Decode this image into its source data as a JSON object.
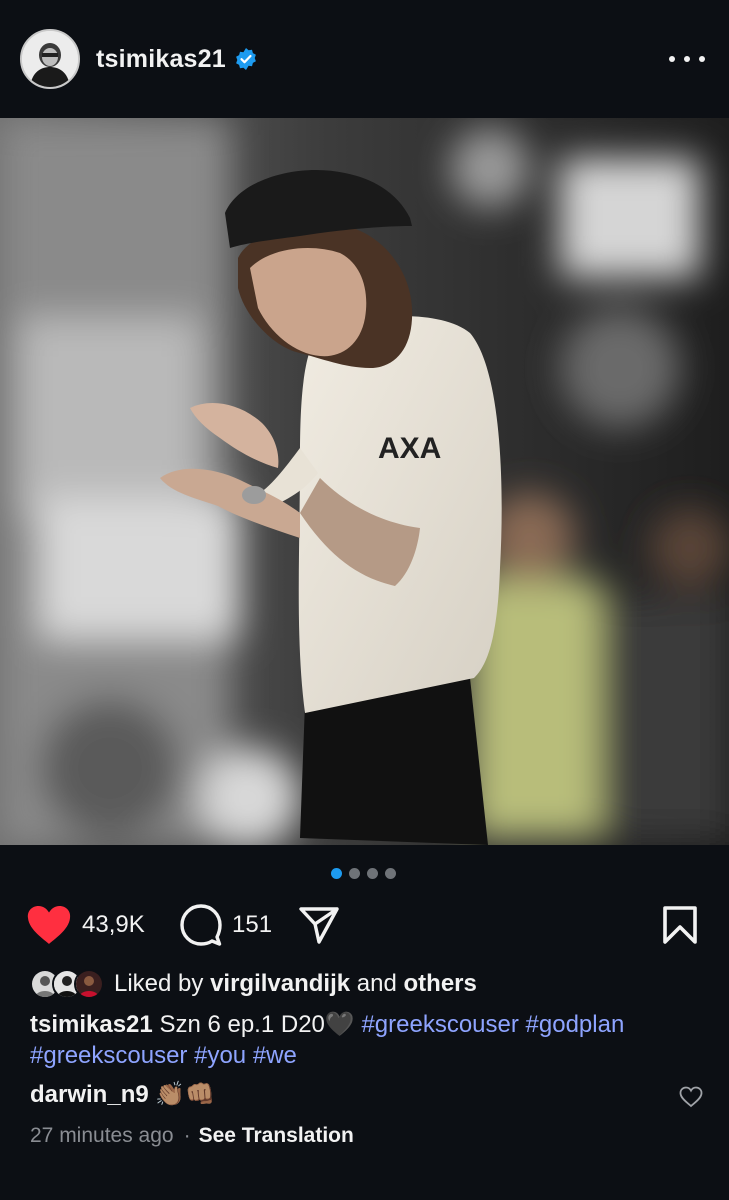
{
  "post": {
    "username": "tsimikas21",
    "verified": true,
    "more_label": "More options"
  },
  "carousel": {
    "count": 4,
    "active_index": 0
  },
  "actions": {
    "likes_count": "43,9K",
    "comments_count": "151"
  },
  "liked_by": {
    "prefix": "Liked by",
    "user": "virgilvandijk",
    "conj": "and",
    "others": "others"
  },
  "caption": {
    "username": "tsimikas21",
    "text": "Szn 6 ep.1 D20🖤",
    "tags_line1": [
      "#greekscouser",
      "#godplan"
    ],
    "tags_line2": [
      "#greekscouser",
      "#you",
      "#we"
    ]
  },
  "comment": {
    "username": "darwin_n9",
    "emoji": "👏🏽👊🏽"
  },
  "meta": {
    "time": "27 minutes ago",
    "separator": "·",
    "see_translation": "See Translation"
  },
  "colors": {
    "background": "#0c0f14",
    "like_red": "#ff2f40",
    "hashtag": "#8ea4ff",
    "verified_blue": "#1d9bf0",
    "dot_active": "#1d9bf0"
  }
}
